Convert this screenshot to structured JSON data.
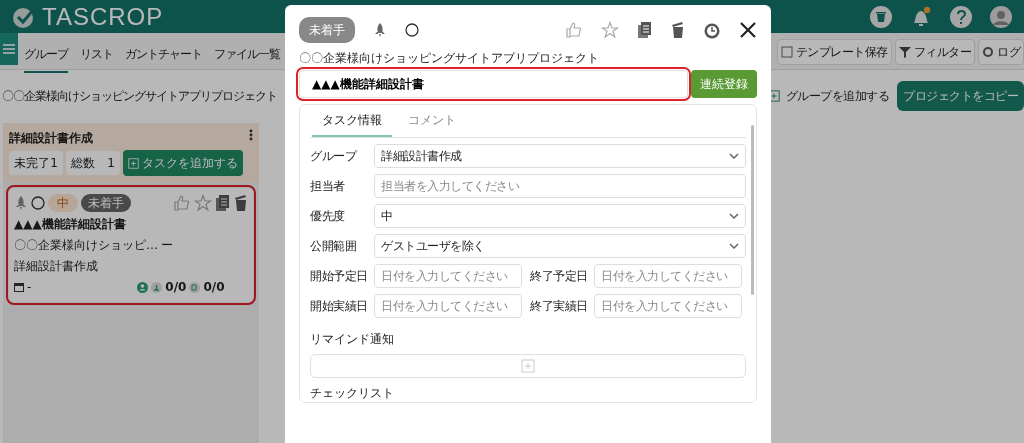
{
  "header": {
    "logo": "TASCROP",
    "notification_dot": true
  },
  "tabs": [
    {
      "label": "グループ",
      "selected": true
    },
    {
      "label": "リスト",
      "selected": false
    },
    {
      "label": "ガントチャート",
      "selected": false
    },
    {
      "label": "ファイル一覧",
      "selected": false
    }
  ],
  "toolbar": [
    {
      "kind": "template",
      "label": "テンプレート保存"
    },
    {
      "kind": "filter",
      "label": "フィルター"
    },
    {
      "kind": "log",
      "label": "ログ"
    }
  ],
  "project_title": "〇〇企業様向けショッピングサイトアプリプロジェクト",
  "add_group": "グループを追加する",
  "copy_project": "プロジェクトをコピー",
  "group": {
    "name": "詳細設計書作成",
    "stats": [
      {
        "label": "未完了",
        "value": "1"
      },
      {
        "label": "総数",
        "value": "1"
      }
    ],
    "add_task": "タスクを追加する",
    "card": {
      "priority": "中",
      "status": "未着手",
      "title": "▲▲▲機能詳細設計書",
      "project": "〇〇企業様向けショッピ…",
      "separator": "ー",
      "group": "詳細設計書作成",
      "date": "-",
      "subtasks": "0/0",
      "checklist": "0/0",
      "highlighted": true
    }
  },
  "modal": {
    "status": "未着手",
    "project": "〇〇企業様向けショッピングサイトアプリプロジェクト",
    "title": "▲▲▲機能詳細設計書",
    "title_highlighted": true,
    "continuous_button": "連続登録",
    "tabs": [
      {
        "label": "タスク情報",
        "selected": true
      },
      {
        "label": "コメント",
        "selected": false
      }
    ],
    "fields": [
      {
        "kind": "select",
        "label": "グループ",
        "value": "詳細設計書作成"
      },
      {
        "kind": "input",
        "label": "担当者",
        "placeholder": "担当者を入力してください"
      },
      {
        "kind": "select",
        "label": "優先度",
        "value": "中"
      },
      {
        "kind": "select",
        "label": "公開範囲",
        "value": "ゲストユーザを除く"
      },
      {
        "kind": "dates",
        "items": [
          {
            "label": "開始予定日",
            "placeholder": "日付を入力してください"
          },
          {
            "label": "終了予定日",
            "placeholder": "日付を入力してください"
          }
        ]
      },
      {
        "kind": "dates",
        "items": [
          {
            "label": "開始実績日",
            "placeholder": "日付を入力してください"
          },
          {
            "label": "終了実績日",
            "placeholder": "日付を入力してください"
          }
        ]
      }
    ],
    "remind_label": "リマインド通知",
    "checklist_label": "チェックリスト"
  }
}
